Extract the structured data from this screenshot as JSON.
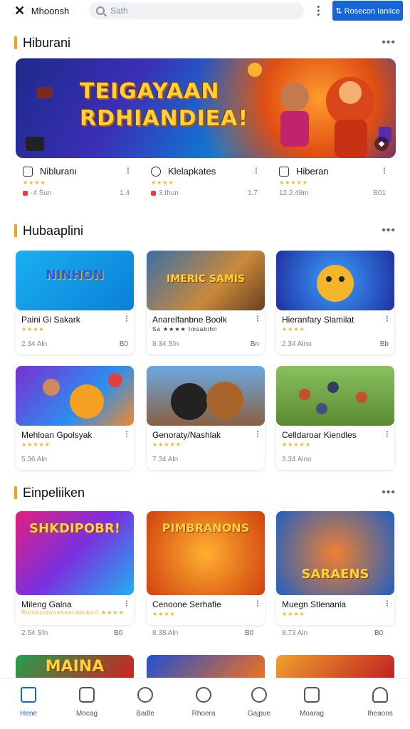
{
  "topbar": {
    "app_title": "Mhoonsh",
    "search_placeholder": "Sath",
    "button_label": "⇅ Rosecon Ianiice"
  },
  "sections": [
    {
      "title": "Hiburani"
    },
    {
      "title": "Hubaaplini"
    },
    {
      "title": "Einpeliiken"
    }
  ],
  "banner": {
    "title_line1": "TEIGAYAAN",
    "title_line2": "RDHIANDIEA!"
  },
  "mini_items": [
    {
      "title": "Nibluranı",
      "stars": "★★★★",
      "meta": "·4 Ŝun",
      "right": "1.4",
      "icon": "app-icon"
    },
    {
      "title": "Klelapkates",
      "stars": "★★★★",
      "meta": "3.thun",
      "right": "1.7",
      "icon": "chat-icon"
    },
    {
      "title": "Hiberan",
      "stars": "★★★★★",
      "meta": "12.2.48m",
      "right": "B01",
      "icon": "tag-icon"
    }
  ],
  "row1": [
    {
      "title": "Paini Gi Sakark",
      "stars": "★★★★",
      "meta": "2.34 Aln",
      "right": "B0",
      "thumb_text": "NINHON"
    },
    {
      "title": "Anarelfanbne Boolk",
      "stars": "Sa ★★★★ Imsabihn",
      "meta": "8.34 Sfn",
      "right": "Bn",
      "thumb_text": "IMERIC SAMIS"
    },
    {
      "title": "Hieranfary Slamilat",
      "stars": "★★★★",
      "meta": "2.34 Alno",
      "right": "Bb",
      "thumb_text": ""
    }
  ],
  "row2": [
    {
      "title": "Mehloan Gpolsyak",
      "stars": "★★★★★",
      "meta": "5.36 Aln",
      "right": "",
      "thumb_text": ""
    },
    {
      "title": "Genoraty/Nashlak",
      "stars": "★★★★★",
      "meta": "7.34 Aln",
      "right": "",
      "thumb_text": ""
    },
    {
      "title": "Celldaroar Kiendles",
      "stars": "★★★★★",
      "meta": "3.34 Alno",
      "right": "",
      "thumb_text": ""
    }
  ],
  "row3": [
    {
      "title": "Mileng Galna",
      "stars": "Rnlvacoloneheermerkerl ★★★★",
      "meta": "2.54 Sfn",
      "right": "B0",
      "thumb_text": "SHKDIPOBR!"
    },
    {
      "title": "Cenoone Serhafie",
      "stars": "★★★★",
      "meta": "8.38 Aln",
      "right": "B0",
      "thumb_text": "PIMBRANONS"
    },
    {
      "title": "Muegn Stlenanla",
      "stars": "★★★★",
      "meta": "8.73 Aln",
      "right": "B0",
      "thumb_text": "SARAENS"
    }
  ],
  "row4": [
    {
      "thumb_text": "MAINA"
    },
    {
      "thumb_text": ""
    },
    {
      "thumb_text": ""
    }
  ],
  "nav": [
    {
      "label": "Hene",
      "icon": "home-icon",
      "active": true
    },
    {
      "label": "Mocag",
      "icon": "box-icon"
    },
    {
      "label": "Badle",
      "icon": "person-icon"
    },
    {
      "label": "Rhoera",
      "icon": "clock-icon"
    },
    {
      "label": "Gajpue",
      "icon": "search-icon"
    },
    {
      "label": "Moarag",
      "icon": "chart-icon"
    },
    {
      "label": "Iheaons",
      "icon": "profile-icon"
    }
  ],
  "colors": {
    "accent": "#f0a21c",
    "primary": "#1466d8",
    "star": "#f0b429"
  }
}
